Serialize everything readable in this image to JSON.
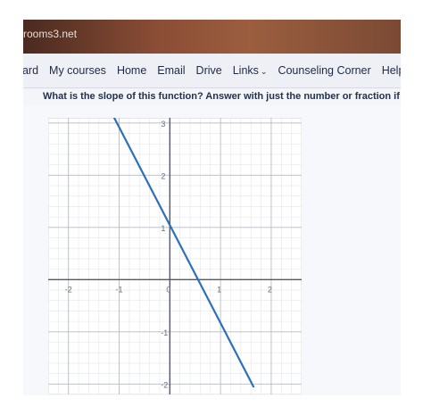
{
  "browser": {
    "domain": "rooms3.net"
  },
  "nav": {
    "items": [
      {
        "label": "oard"
      },
      {
        "label": "My courses"
      },
      {
        "label": "Home"
      },
      {
        "label": "Email"
      },
      {
        "label": "Drive"
      },
      {
        "label": "Links",
        "has_dropdown": true
      },
      {
        "label": "Counseling Corner"
      },
      {
        "label": "Help Desk"
      }
    ]
  },
  "question": {
    "text": "What is the slope of this function? Answer with just the number or fraction if n"
  },
  "graph": {
    "x_ticks": [
      "-2",
      "-1",
      "0",
      "1",
      "2"
    ],
    "y_ticks": [
      "3",
      "2",
      "1",
      "-1",
      "-2"
    ],
    "line_color": "#2f6fb8"
  },
  "chart_data": {
    "type": "line",
    "title": "",
    "xlabel": "",
    "ylabel": "",
    "xlim": [
      -2.4,
      2.6
    ],
    "ylim": [
      -2.2,
      3.1
    ],
    "grid": true,
    "series": [
      {
        "x": [
          -1.15,
          1.65
        ],
        "y": [
          3.2,
          -2.05
        ]
      }
    ]
  }
}
